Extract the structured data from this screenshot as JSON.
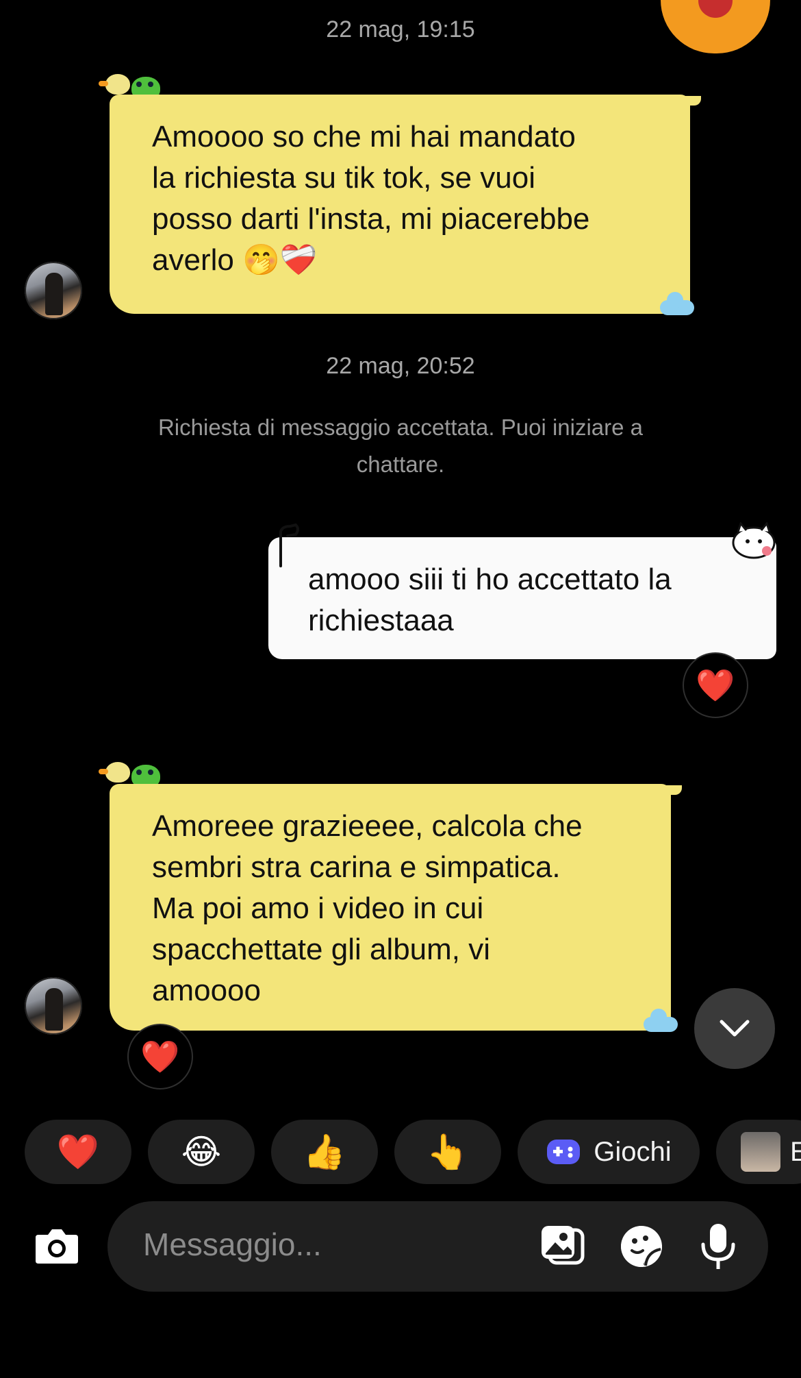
{
  "header": {
    "timestamp_1": "22 mag, 19:15",
    "timestamp_2": "22 mag, 20:52"
  },
  "messages": [
    {
      "side": "incoming",
      "text": "Amoooo so che mi hai mandato\nla richiesta su tik tok, se vuoi\nposso darti l'insta, mi piacerebbe\naverlo 🤭❤️‍🩹"
    },
    {
      "side": "outgoing",
      "text": "amooo siii ti ho accettato la\nrichiestaaa",
      "reaction": "❤️"
    },
    {
      "side": "incoming",
      "text": "Amoreee grazieeee, calcola che\nsembri stra carina e simpatica.\nMa poi amo i video in cui\nspacchettate gli album, vi\namoooo",
      "reaction": "❤️"
    }
  ],
  "system_message": "Richiesta di messaggio accettata. Puoi iniziare a\nchattare.",
  "quick_reactions": [
    {
      "emoji": "❤️"
    },
    {
      "emoji": "😂"
    },
    {
      "emoji": "👍"
    },
    {
      "emoji": "👆"
    },
    {
      "emoji": "🎮",
      "label": "Giochi"
    },
    {
      "label": "E"
    }
  ],
  "composer": {
    "placeholder": "Messaggio..."
  },
  "icons": [
    "camera-icon",
    "gallery-icon",
    "sticker-icon",
    "microphone-icon",
    "chevron-down-icon",
    "gamepad-icon"
  ],
  "colors": {
    "incoming_bubble": "#f3e57a",
    "outgoing_bubble": "#fafafa",
    "background": "#000000",
    "chip_bg": "#1f1f1f",
    "gamepad": "#5b5cf5"
  }
}
